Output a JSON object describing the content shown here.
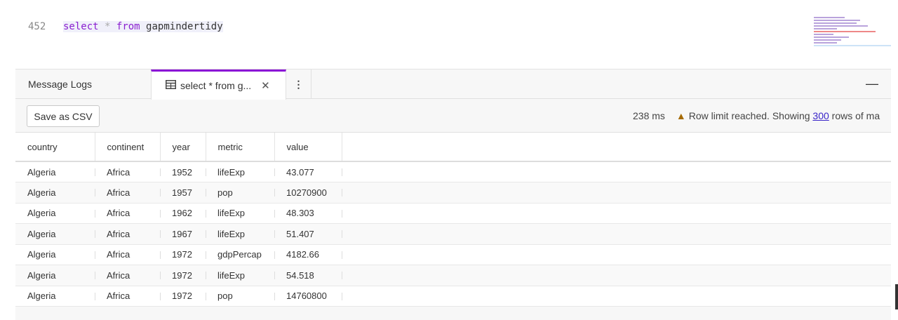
{
  "editor": {
    "line_number": "452",
    "code": {
      "kw1": "select",
      "op": "*",
      "kw2": "from",
      "table": "gapmindertidy"
    }
  },
  "tabs": [
    {
      "label": "Message Logs"
    },
    {
      "label": "select * from g...",
      "icon": "table-icon"
    }
  ],
  "toolbar": {
    "save_label": "Save as CSV",
    "elapsed": "238 ms",
    "warning_prefix": "Row limit reached. Showing",
    "row_count": "300",
    "warning_suffix": "rows of ma"
  },
  "table": {
    "columns": [
      "country",
      "continent",
      "year",
      "metric",
      "value"
    ],
    "rows": [
      [
        "Algeria",
        "Africa",
        "1952",
        "lifeExp",
        "43.077"
      ],
      [
        "Algeria",
        "Africa",
        "1957",
        "pop",
        "10270900"
      ],
      [
        "Algeria",
        "Africa",
        "1962",
        "lifeExp",
        "48.303"
      ],
      [
        "Algeria",
        "Africa",
        "1967",
        "lifeExp",
        "51.407"
      ],
      [
        "Algeria",
        "Africa",
        "1972",
        "gdpPercap",
        "4182.66"
      ],
      [
        "Algeria",
        "Africa",
        "1972",
        "lifeExp",
        "54.518"
      ],
      [
        "Algeria",
        "Africa",
        "1972",
        "pop",
        "14760800"
      ]
    ]
  },
  "colors": {
    "accent": "#8a12d6",
    "link": "#3a25c9",
    "warning": "#a56a00"
  }
}
